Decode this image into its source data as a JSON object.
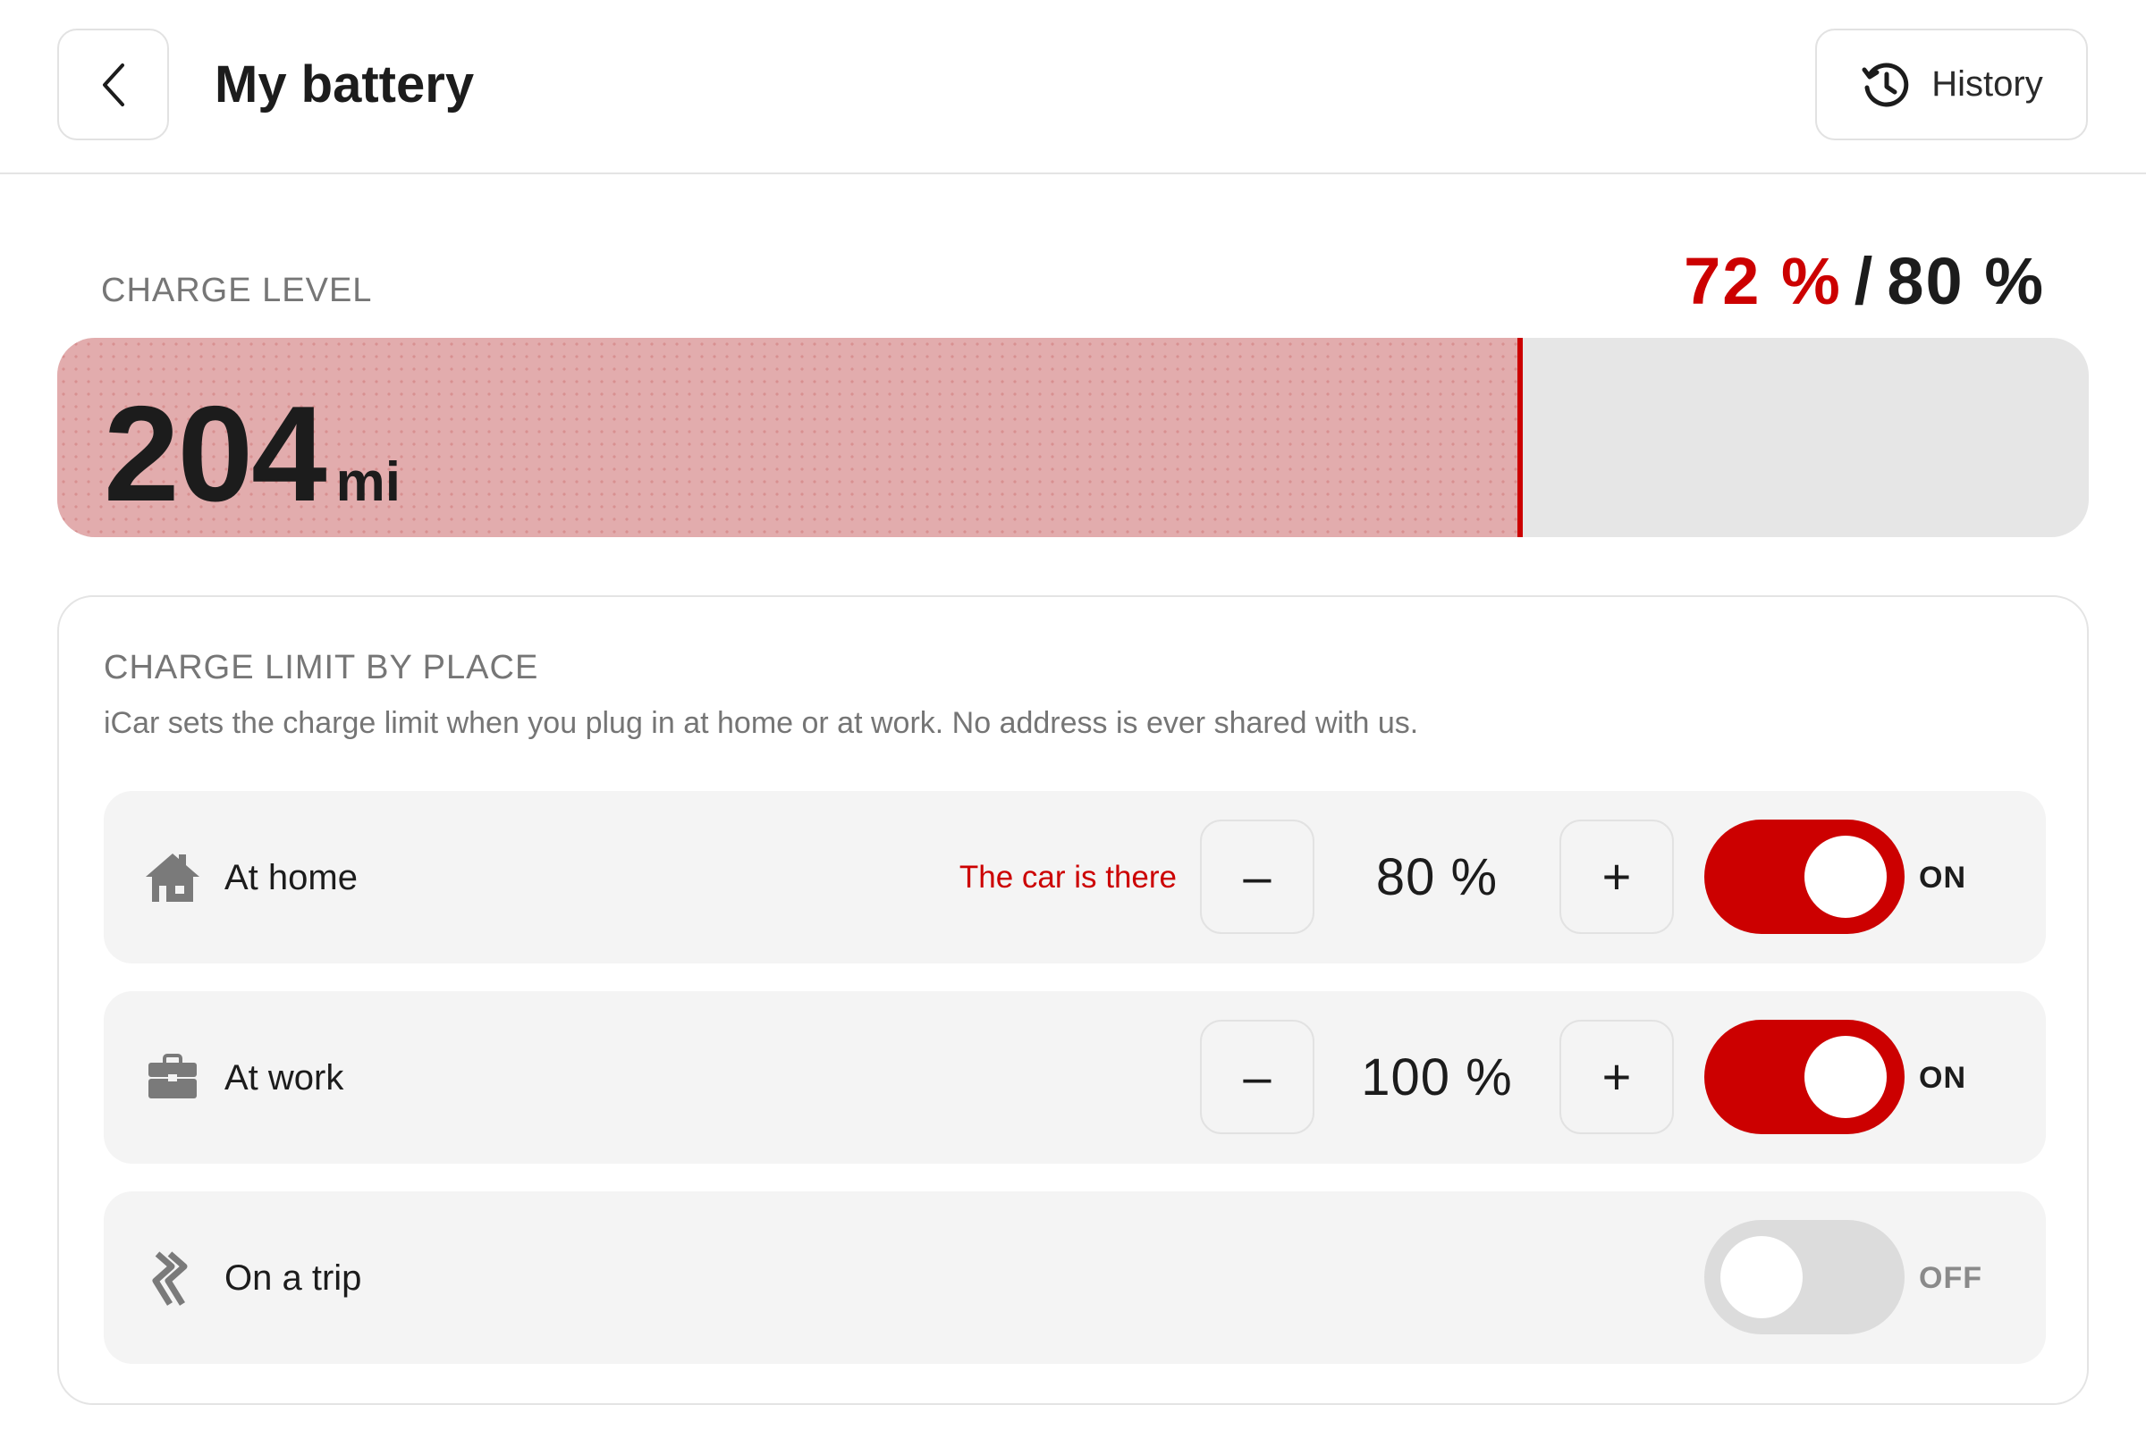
{
  "header": {
    "title": "My battery",
    "history_label": "History",
    "back_icon": "chevron-left-icon",
    "history_icon": "history-clock-icon"
  },
  "charge": {
    "section_label": "CHARGE LEVEL",
    "current_percent": "72 %",
    "separator": "/",
    "limit_percent": "80 %",
    "level_fraction": 0.72,
    "range_value": "204",
    "range_unit": "mi",
    "accent_color": "#cc0000"
  },
  "places": {
    "title": "CHARGE LIMIT BY PLACE",
    "description": "iCar sets the charge limit when you plug in at home or at work. No address is ever shared with us.",
    "rows": [
      {
        "icon": "house-icon",
        "name": "At home",
        "status": "The car is there",
        "minus_label": "–",
        "limit": "80 %",
        "plus_label": "+",
        "state": "ON"
      },
      {
        "icon": "briefcase-icon",
        "name": "At work",
        "minus_label": "–",
        "limit": "100 %",
        "plus_label": "+",
        "state": "ON"
      },
      {
        "icon": "road-icon",
        "name": "On a trip",
        "state": "OFF"
      }
    ]
  }
}
